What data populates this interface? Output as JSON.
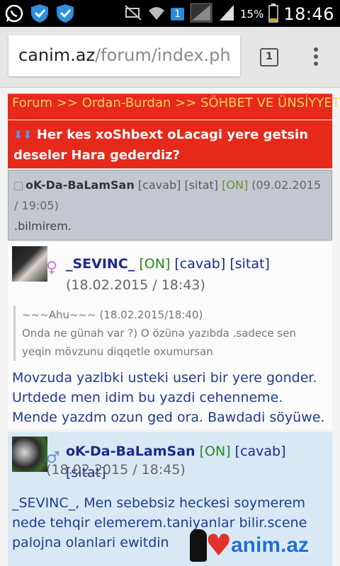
{
  "status_bar": {
    "battery_percent": "15%",
    "time": "18:46",
    "notification_count": "1",
    "icons": [
      "whatsapp-icon",
      "shield-icon",
      "shield-icon",
      "mute-icon",
      "wifi-icon",
      "signal-icon",
      "battery-icon"
    ]
  },
  "browser": {
    "url_host": "canim.az",
    "url_path": "/forum/index.ph",
    "tab_count": "1"
  },
  "breadcrumb": {
    "items": [
      "Forum",
      "Ordan-Burdan",
      "SÖHBET VE ÜNSİYYET"
    ],
    "separator": ">>"
  },
  "topic": {
    "arrows": "⬇⬇",
    "title": "Her kes xoShbext oLacagi yere getsin deseler Hara gederdiz?"
  },
  "posts": [
    {
      "author": "oK-Da-BaLamSan",
      "reply": "[cavab]",
      "quote": "[sitat]",
      "status": "[ON]",
      "date_open": "(09.02.2015 /",
      "date_close": "19:05)",
      "message": ".bilmirem."
    },
    {
      "author": "_SEVINC_",
      "gender": "♀",
      "status": "[ON]",
      "reply": "[cavab]",
      "quote": "[sitat]",
      "date_open": "(18.02.2015 /",
      "date_close": "18:43)",
      "quoted_header": "~~~Ahu~~~ (18.02.2015/18:40)",
      "quoted_text": "Onda ne günah var ?) O özünə yazıbda .sadece sen yeqin mövzunu diqqetle oxumursan",
      "message": "Movzuda yazlbki usteki useri bir yere gonder. Urtdede men idim bu yazdi cehenneme. Mende yazdm ozun ged ora. Bawdadi söyüwe."
    },
    {
      "author": "oK-Da-BaLamSan",
      "gender": "♂",
      "status": "[ON]",
      "reply": "[cavab]",
      "quote": "[sitat]",
      "date": "(18.02.2015 / 18:45)",
      "message": "_SEVINC_, Men sebebsiz heckesi soymerem nede tehqir elemerem.taniyanlar bilir.scene palojna olanlari ewitdin"
    }
  ],
  "watermark": {
    "text": "anim.az"
  }
}
